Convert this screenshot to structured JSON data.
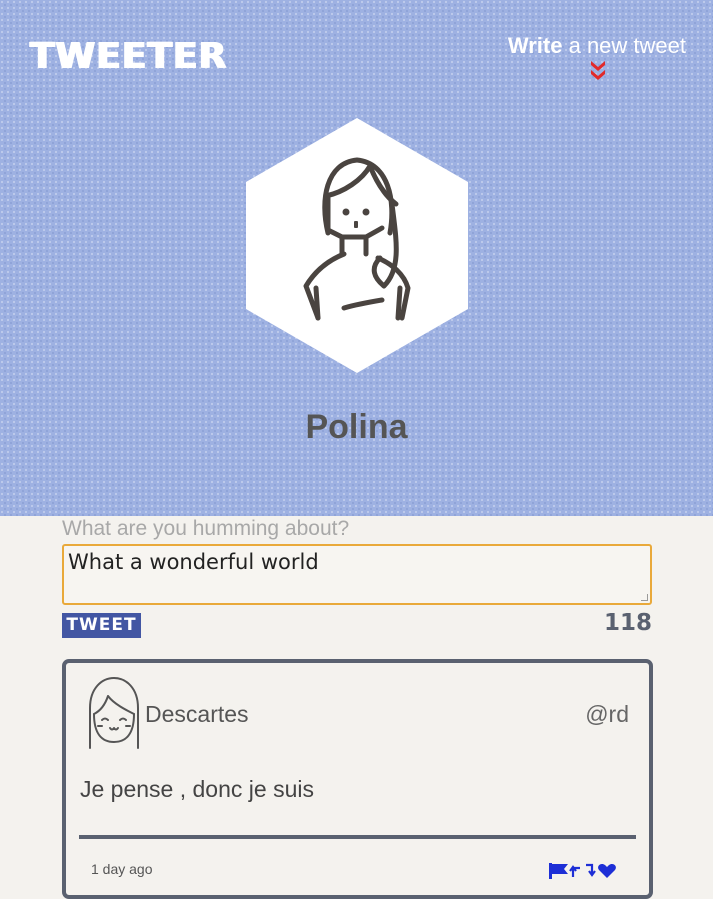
{
  "header": {
    "logo": "TWEETER",
    "write_bold": "Write",
    "write_rest": " a new tweet",
    "chevron_icon": "double-chevron-down-icon",
    "chevron_color": "#e12a2a"
  },
  "profile": {
    "name": "Polina",
    "avatar_icon": "girl-avatar-icon"
  },
  "compose": {
    "label": "What are you humming about?",
    "value": "What a wonderful world",
    "button": "TWEET",
    "counter": "118"
  },
  "tweets": [
    {
      "name": "Descartes",
      "handle": "@rd",
      "text": "Je pense , donc je suis",
      "time": "1 day ago",
      "avatar_icon": "smiling-girl-avatar-icon",
      "action_icons": [
        "flag-icon",
        "retweet-icon",
        "heart-icon"
      ]
    }
  ],
  "colors": {
    "hero_bg": "#9eb1e2",
    "page_bg": "#f4f2ee",
    "accent": "#4256a3",
    "input_border": "#e9a93a",
    "card_border": "#5a6170"
  }
}
